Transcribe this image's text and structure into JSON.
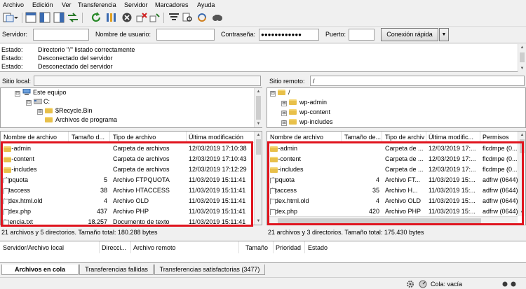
{
  "menu": [
    "Archivo",
    "Edición",
    "Ver",
    "Transferencia",
    "Servidor",
    "Marcadores",
    "Ayuda"
  ],
  "quickconnect": {
    "server_label": "Servidor:",
    "server_value": "",
    "user_label": "Nombre de usuario:",
    "user_value": "",
    "password_label": "Contraseña:",
    "password_value": "●●●●●●●●●●●●",
    "port_label": "Puerto:",
    "port_value": "",
    "connect_label": "Conexión rápida",
    "dropdown_icon": "▼"
  },
  "log": [
    {
      "key": "Estado:",
      "value": "Directorio \"/\" listado correctamente"
    },
    {
      "key": "Estado:",
      "value": "Desconectado del servidor"
    },
    {
      "key": "Estado:",
      "value": "Desconectado del servidor"
    }
  ],
  "local": {
    "site_label": "Sitio local:",
    "site_path": "",
    "tree": [
      {
        "label": "Este equipo",
        "expander": "⊟",
        "icon": "computer-icon"
      },
      {
        "label": "C:",
        "expander": "⊟",
        "icon": "drive-icon"
      },
      {
        "label": "$Recycle.Bin",
        "expander": "⊞",
        "icon": "folder-icon"
      },
      {
        "label": "Archivos de programa",
        "expander": "",
        "icon": "folder-icon"
      }
    ],
    "columns": [
      "Nombre de archivo",
      "Tamaño d...",
      "Tipo de archivo",
      "Última modificación"
    ],
    "rows": [
      {
        "name": "wp-admin",
        "size": "",
        "type": "Carpeta de archivos",
        "modified": "12/03/2019 17:10:38",
        "folder": true
      },
      {
        "name": "wp-content",
        "size": "",
        "type": "Carpeta de archivos",
        "modified": "12/03/2019 17:10:43",
        "folder": true
      },
      {
        "name": "wp-includes",
        "size": "",
        "type": "Carpeta de archivos",
        "modified": "12/03/2019 17:12:29",
        "folder": true
      },
      {
        "name": ".ftpquota",
        "size": "5",
        "type": "Archivo FTPQUOTA",
        "modified": "11/03/2019 15:11:41",
        "folder": false
      },
      {
        "name": ".htaccess",
        "size": "38",
        "type": "Archivo HTACCESS",
        "modified": "11/03/2019 15:11:41",
        "folder": false
      },
      {
        "name": "index.html.old",
        "size": "4",
        "type": "Archivo OLD",
        "modified": "11/03/2019 15:11:41",
        "folder": false
      },
      {
        "name": "index.php",
        "size": "437",
        "type": "Archivo PHP",
        "modified": "11/03/2019 15:11:41",
        "folder": false
      },
      {
        "name": "licencia.txt",
        "size": "18.257",
        "type": "Documento de texto",
        "modified": "11/03/2019 15:11:41",
        "folder": false
      }
    ],
    "summary": "21 archivos y 5 directorios. Tamaño total: 180.288 bytes"
  },
  "remote": {
    "site_label": "Sitio remoto:",
    "site_path": "/",
    "tree": [
      {
        "label": "/",
        "expander": "⊟",
        "icon": "folder-icon"
      },
      {
        "label": "wp-admin",
        "expander": "⊞",
        "icon": "folder-icon"
      },
      {
        "label": "wp-content",
        "expander": "⊞",
        "icon": "folder-icon"
      },
      {
        "label": "wp-includes",
        "expander": "⊞",
        "icon": "folder-icon"
      }
    ],
    "columns": [
      "Nombre de archivo",
      "Tamaño de...",
      "Tipo de archiv",
      "Última modific...",
      "Permisos"
    ],
    "rows": [
      {
        "name": "wp-admin",
        "size": "",
        "type": "Carpeta de ...",
        "modified": "12/03/2019 17:...",
        "perms": "flcdmpe (0...",
        "folder": true
      },
      {
        "name": "wp-content",
        "size": "",
        "type": "Carpeta de ...",
        "modified": "12/03/2019 17:...",
        "perms": "flcdmpe (0...",
        "folder": true
      },
      {
        "name": "wp-includes",
        "size": "",
        "type": "Carpeta de ...",
        "modified": "12/03/2019 17:...",
        "perms": "flcdmpe (0...",
        "folder": true
      },
      {
        "name": ".ftpquota",
        "size": "4",
        "type": "Archivo FT...",
        "modified": "11/03/2019 15:...",
        "perms": "adfrw (0644)",
        "folder": false
      },
      {
        "name": ".htaccess",
        "size": "35",
        "type": "Archivo H...",
        "modified": "11/03/2019 15:...",
        "perms": "adfrw (0644)",
        "folder": false
      },
      {
        "name": "index.html.old",
        "size": "4",
        "type": "Archivo OLD",
        "modified": "11/03/2019 15:...",
        "perms": "adfrw (0644)",
        "folder": false
      },
      {
        "name": "index.php",
        "size": "420",
        "type": "Archivo PHP",
        "modified": "11/03/2019 15:...",
        "perms": "adfrw (0644)",
        "folder": false
      }
    ],
    "summary": "21 archivos y 3 directorios. Tamaño total: 175.430 bytes"
  },
  "queue": {
    "columns": [
      "Servidor/Archivo local",
      "Direcci...",
      "Archivo remoto",
      "Tamaño",
      "Prioridad",
      "Estado"
    ]
  },
  "tabs": [
    "Archivos en cola",
    "Transferencias fallidas",
    "Transferencias satisfactorias (3477)"
  ],
  "status": {
    "queue_label": "Cola: vacía"
  },
  "colors": {
    "highlight": "#e0141e",
    "folder": "#e8c04a"
  }
}
